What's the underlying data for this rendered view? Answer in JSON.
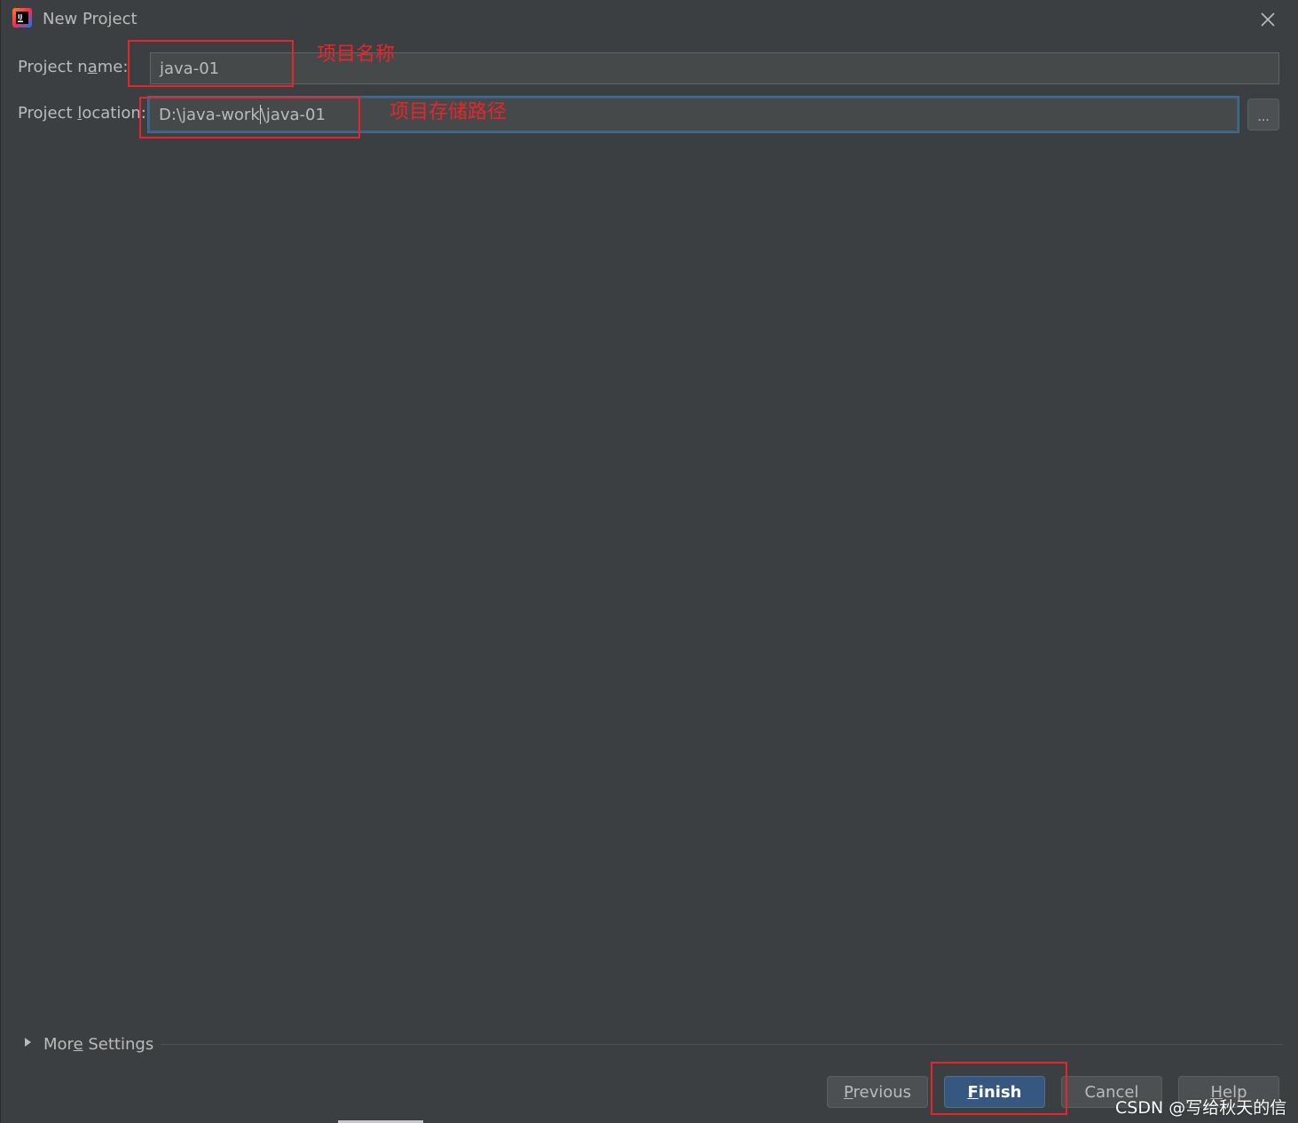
{
  "window": {
    "title": "New Project",
    "app_icon": "intellij-idea-icon",
    "close_icon": "close-icon"
  },
  "form": {
    "name_label": "Project name:",
    "name_value": "java-01",
    "location_label": "Project location:",
    "location_value_before_cursor": "D:\\java-work",
    "location_value_after_cursor": "\\java-01",
    "browse_label": "..."
  },
  "annotations": {
    "name_note": "项目名称",
    "location_note": "项目存储路径",
    "color": "#e8252a"
  },
  "more_settings": {
    "label": "More Settings",
    "icon": "triangle-right-icon"
  },
  "buttons": {
    "previous": "Previous",
    "finish": "Finish",
    "cancel": "Cancel",
    "help": "Help"
  },
  "watermark": "CSDN @写给秋天的信",
  "colors": {
    "background": "#3c3f41",
    "field": "#45494a",
    "focus": "#3d6185",
    "primary_button": "#365880"
  }
}
